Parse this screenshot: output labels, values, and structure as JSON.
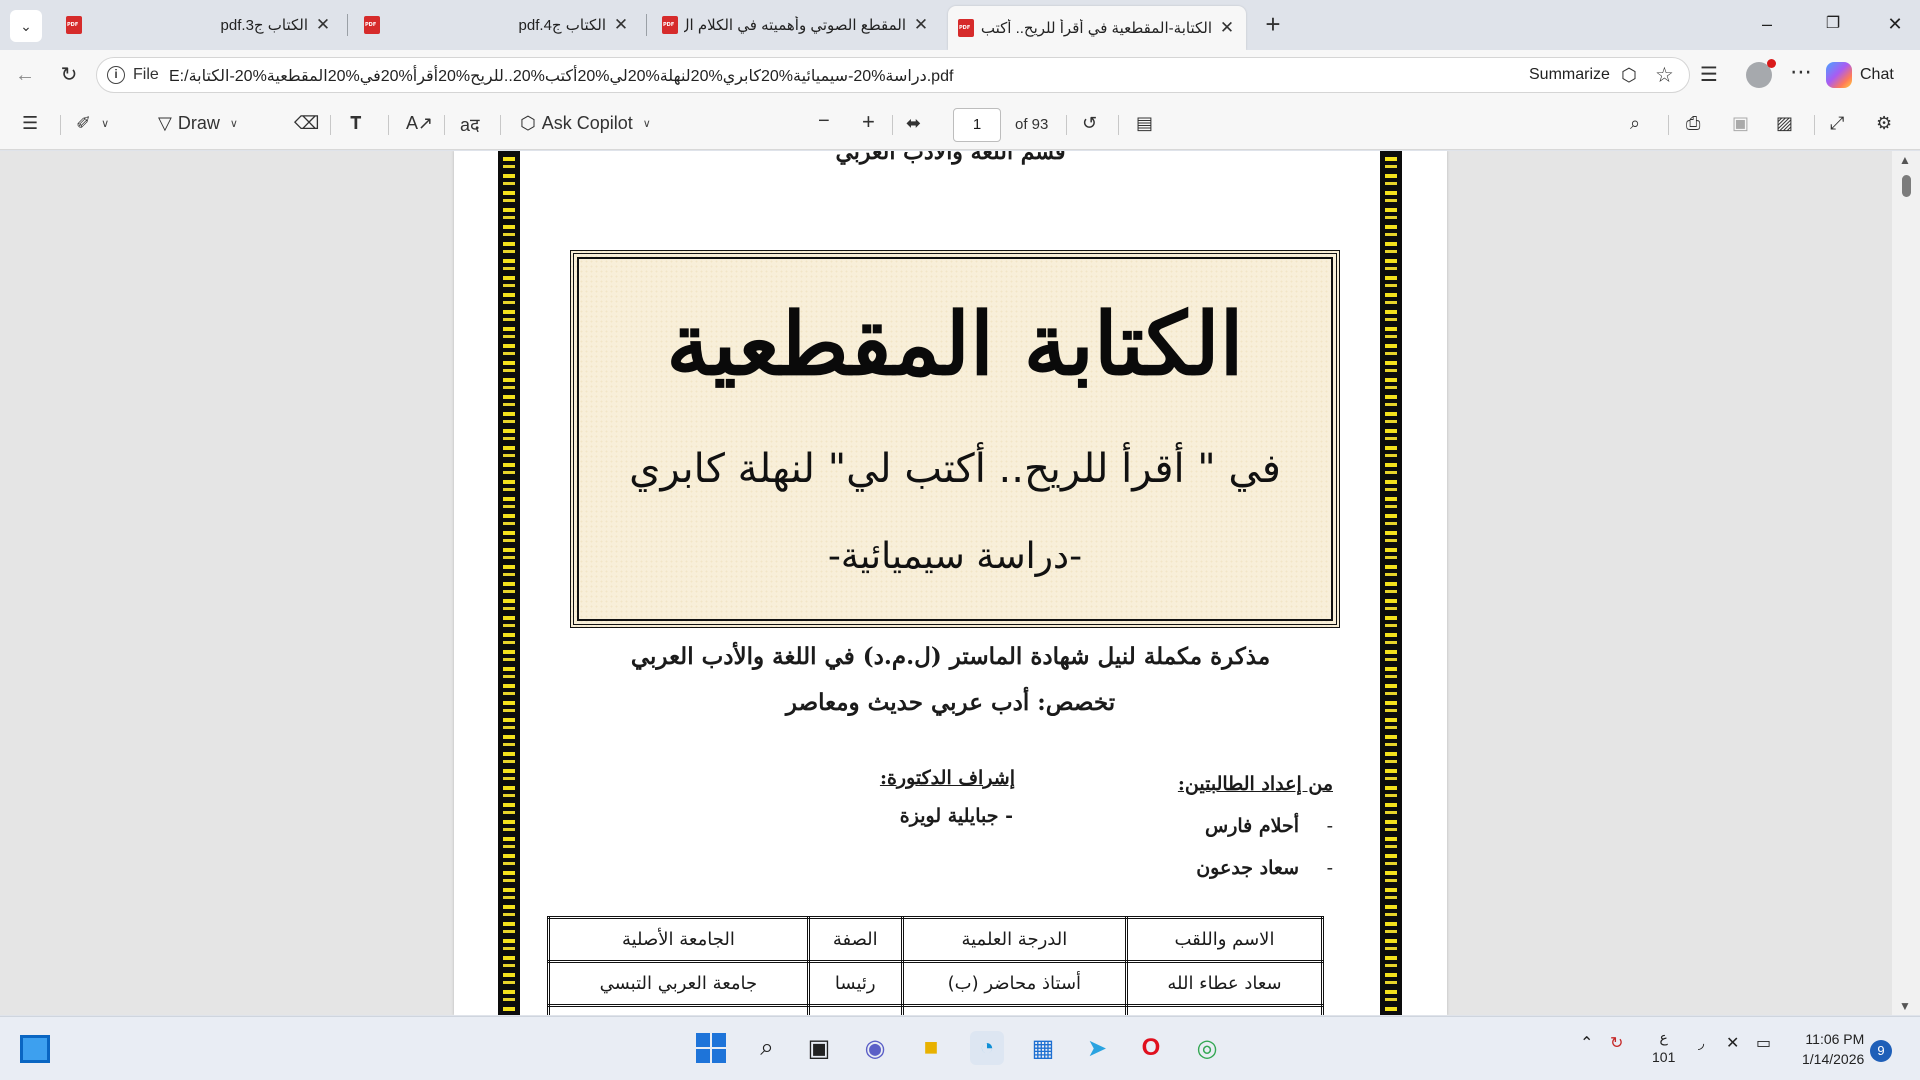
{
  "tabs": [
    {
      "title": "الكتاب ج3.pdf",
      "active": false
    },
    {
      "title": "الكتاب ج4.pdf",
      "active": false
    },
    {
      "title": "المقطع الصوتي وأهميته في الكلام ال",
      "active": false
    },
    {
      "title": "الكتابة-المقطعية في أقرأ للريح.. أكتب",
      "active": true
    }
  ],
  "window_controls": {
    "minimize": "–",
    "maximize": "❐",
    "close": "✕"
  },
  "address": {
    "scheme": "File",
    "url": "E:/دراسة%20-سيميائية%20كابري%20لنهلة%20لي%20أكتب%20..للريح%20أقرأ%20في%20المقطعية%20-الكتابة.pdf",
    "summarize_label": "Summarize",
    "chat_label": "Chat"
  },
  "toolbar": {
    "draw_label": "Draw",
    "ask_copilot_label": "Ask Copilot",
    "page_current": "1",
    "page_total": "of 93"
  },
  "document": {
    "clipped_top_line": "قسم اللغة والأدب العربي",
    "main_title": "الكتابة المقطعية",
    "sub_title": "في \" أقرأ للريح.. أكتب لي\" لنهلة كابري",
    "sub_title2": "-دراسة سيميائية-",
    "memo_line1": "مذكرة مكملة لنيل شهادة الماستر (ل.م.د) في اللغة والأدب العربي",
    "memo_line2": "تخصص: أدب عربي حديث ومعاصر",
    "students_label": "من إعداد الطالبتين:",
    "student1": "أحلام فارس",
    "student2": "سعاد جدعون",
    "dash1": "-",
    "dash2": "-",
    "supervisor_label": "إشراف الدكتورة:",
    "supervisor_name": "- جبايلية لويزة",
    "table_headers": [
      "الاسم واللقب",
      "الدرجة العلمية",
      "الصفة",
      "الجامعة الأصلية"
    ],
    "table_rows": [
      [
        "سعاد عطاء الله",
        "أستاذ محاضر (ب)",
        "رئيسا",
        "جامعة العربي التبسي"
      ]
    ]
  },
  "taskbar": {
    "lang_top": "ع",
    "lang_bottom": "101",
    "time": "11:06 PM",
    "date": "1/14/2026",
    "notifications": "9"
  }
}
